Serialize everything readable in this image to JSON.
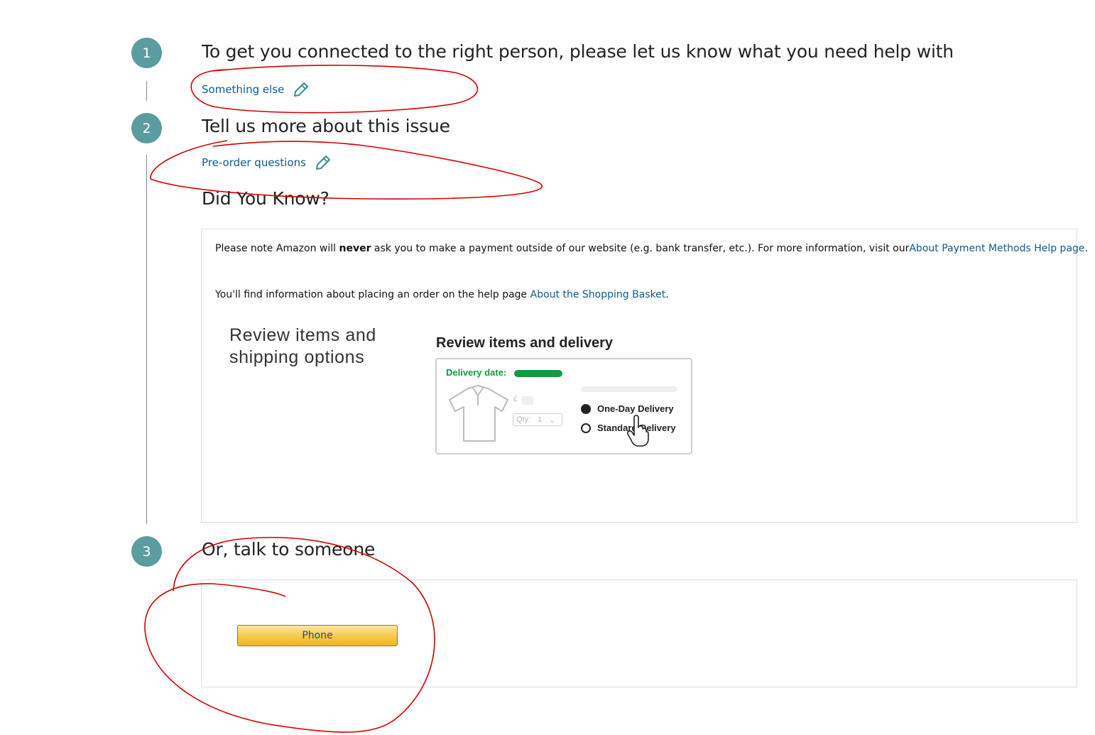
{
  "steps": [
    {
      "number": "1",
      "title": "To get you connected to the right person, please let us know what you need help with"
    },
    {
      "number": "2",
      "title": "Tell us more about this issue"
    },
    {
      "number": "3",
      "title": "Or, talk to someone"
    }
  ],
  "selections": {
    "step1_choice": "Something else",
    "step2_choice": "Pre-order questions",
    "edit_icon": "pencil-icon"
  },
  "did_you_know": {
    "heading": "Did You Know?",
    "payment_note_prefix": "Please note Amazon will ",
    "payment_note_bold": "never",
    "payment_note_suffix": " ask you to make a payment outside of our website (e.g. bank transfer, etc.). For more information, visit our",
    "payment_link": "About Payment Methods Help page",
    "payment_note_end": ".",
    "basket_note_prefix": "You'll find information about placing an order on the help page ",
    "basket_link": "About the Shopping Basket",
    "basket_note_end": "."
  },
  "illustration": {
    "left_caption": "Review items and shipping options",
    "heading": "Review items and delivery",
    "delivery_label": "Delivery date:",
    "currency_symbol": "£",
    "qty_label": "Qty:",
    "qty_value": "1",
    "option_one": "One-Day Delivery",
    "option_two": "Standard Delivery"
  },
  "contact": {
    "phone_label": "Phone"
  },
  "colors": {
    "step_badge": "#5b9ca0",
    "link": "#0f5a8a",
    "annotation": "#d40000",
    "delivery_green": "#139a3e",
    "button_yellow": "#f7c84a"
  }
}
